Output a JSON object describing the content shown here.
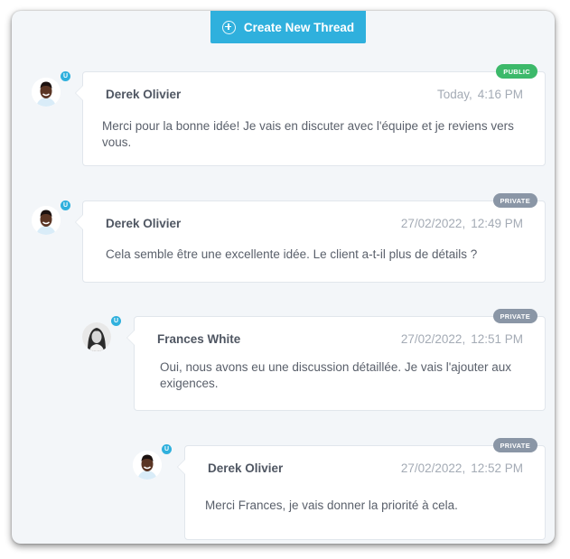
{
  "header": {
    "create_thread_label": "Create New Thread"
  },
  "badge_letter": "U",
  "threads": [
    {
      "author": "Derek Olivier",
      "date": "Today,",
      "time": "4:16 PM",
      "visibility": "PUBLIC",
      "message": "Merci pour la bonne idée! Je vais en discuter avec l'équipe et je reviens vers vous."
    },
    {
      "author": "Derek Olivier",
      "date": "27/02/2022,",
      "time": "12:49 PM",
      "visibility": "PRIVATE",
      "message": "Cela semble être une excellente idée. Le client a-t-il plus de détails ?"
    },
    {
      "author": "Frances White",
      "date": "27/02/2022,",
      "time": "12:51 PM",
      "visibility": "PRIVATE",
      "message": "Oui, nous avons eu une discussion détaillée. Je vais l'ajouter aux exigences."
    },
    {
      "author": "Derek Olivier",
      "date": "27/02/2022,",
      "time": "12:52 PM",
      "visibility": "PRIVATE",
      "message": "Merci Frances, je vais donner la priorité à cela."
    }
  ],
  "colors": {
    "accent": "#2fb0dd",
    "public": "#3cb96a",
    "private": "#8a96a6"
  }
}
